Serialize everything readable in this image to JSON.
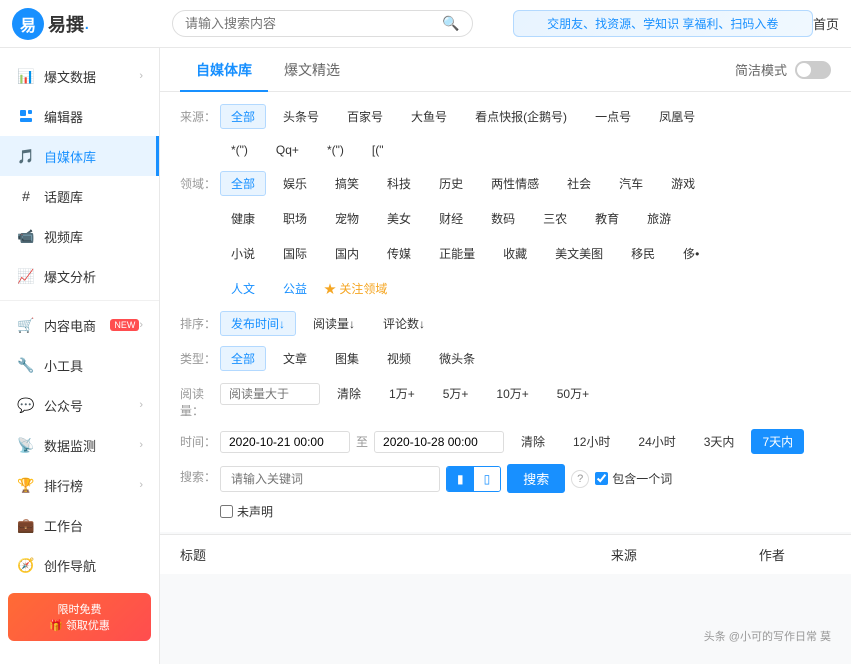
{
  "app": {
    "logo_text": "易撰",
    "logo_dot": ".",
    "search_placeholder": "请输入搜索内容",
    "banner_text": "交朋友、找资源、学知识\n享福利、扫码入卷",
    "nav_home": "首页"
  },
  "sidebar": {
    "items": [
      {
        "id": "baowendata",
        "label": "爆文数据",
        "icon": "📊",
        "has_arrow": true,
        "active": false
      },
      {
        "id": "bianji",
        "label": "编辑器",
        "icon": "✏️",
        "has_arrow": false,
        "active": false
      },
      {
        "id": "zimeiti",
        "label": "自媒体库",
        "icon": "🎵",
        "has_arrow": false,
        "active": true
      },
      {
        "id": "huati",
        "label": "话题库",
        "icon": "🏷️",
        "has_arrow": false,
        "active": false
      },
      {
        "id": "shipinku",
        "label": "视频库",
        "icon": "📹",
        "has_arrow": false,
        "active": false
      },
      {
        "id": "baowen_fenxi",
        "label": "爆文分析",
        "icon": "📈",
        "has_arrow": false,
        "active": false
      },
      {
        "id": "neirong_diangshang",
        "label": "内容电商",
        "icon": "🛒",
        "has_arrow": true,
        "active": false,
        "new_badge": true
      },
      {
        "id": "xiao_gongju",
        "label": "小工具",
        "icon": "",
        "has_arrow": false,
        "active": false
      },
      {
        "id": "gongzhonghao",
        "label": "公众号",
        "icon": "",
        "has_arrow": true,
        "active": false
      },
      {
        "id": "shuju_jiance",
        "label": "数据监测",
        "icon": "",
        "has_arrow": true,
        "active": false
      },
      {
        "id": "paihangbang",
        "label": "排行榜",
        "icon": "",
        "has_arrow": true,
        "active": false
      },
      {
        "id": "gongtai",
        "label": "工作台",
        "icon": "",
        "has_arrow": false,
        "active": false
      },
      {
        "id": "chuangzuo_daohang",
        "label": "创作导航",
        "icon": "",
        "has_arrow": false,
        "active": false
      }
    ]
  },
  "tabs": {
    "items": [
      {
        "id": "zimeiti_ku",
        "label": "自媒体库",
        "active": true
      },
      {
        "id": "baowen_jingxuan",
        "label": "爆文精选",
        "active": false
      },
      {
        "id": "jianjie_moshi",
        "label": "简洁模式",
        "active": false
      }
    ],
    "toggle_label": "简洁模式"
  },
  "filters": {
    "source_label": "来源：",
    "source_options": [
      {
        "id": "all",
        "label": "全部",
        "active": true
      },
      {
        "id": "toutiao",
        "label": "头条号",
        "active": false
      },
      {
        "id": "baijia",
        "label": "百家号",
        "active": false
      },
      {
        "id": "dayu",
        "label": "大鱼号",
        "active": false
      },
      {
        "id": "kandian",
        "label": "看点快报(企鹅号)",
        "active": false
      },
      {
        "id": "yidian",
        "label": "一点号",
        "active": false
      },
      {
        "id": "fenghuang",
        "label": "凤凰号",
        "active": false
      }
    ],
    "source_extra": [
      {
        "id": "wx",
        "label": "*(\")",
        "active": false
      },
      {
        "id": "qq",
        "label": "Qq+",
        "active": false
      },
      {
        "id": "wx2",
        "label": "*(\")",
        "active": false
      },
      {
        "id": "other",
        "label": "[(\"",
        "active": false
      }
    ],
    "domain_label": "领域：",
    "domain_options": [
      {
        "id": "all",
        "label": "全部",
        "active": true
      },
      {
        "id": "yule",
        "label": "娱乐",
        "active": false
      },
      {
        "id": "gaoxiao",
        "label": "搞笑",
        "active": false
      },
      {
        "id": "keji",
        "label": "科技",
        "active": false
      },
      {
        "id": "lishi",
        "label": "历史",
        "active": false
      },
      {
        "id": "liangxing",
        "label": "两性情感",
        "active": false
      },
      {
        "id": "shehui",
        "label": "社会",
        "active": false
      },
      {
        "id": "qiche",
        "label": "汽车",
        "active": false
      },
      {
        "id": "youxi",
        "label": "游戏",
        "active": false
      },
      {
        "id": "jiankang",
        "label": "健康",
        "active": false
      },
      {
        "id": "zhichang",
        "label": "职场",
        "active": false
      },
      {
        "id": "chongwu",
        "label": "宠物",
        "active": false
      },
      {
        "id": "meinv",
        "label": "美女",
        "active": false
      },
      {
        "id": "caijing",
        "label": "财经",
        "active": false
      },
      {
        "id": "shuma",
        "label": "数码",
        "active": false
      },
      {
        "id": "sannong",
        "label": "三农",
        "active": false
      },
      {
        "id": "jiaoyu",
        "label": "教育",
        "active": false
      },
      {
        "id": "luyou",
        "label": "旅游",
        "active": false
      },
      {
        "id": "xiaoshuo",
        "label": "小说",
        "active": false
      },
      {
        "id": "guoji",
        "label": "国际",
        "active": false
      },
      {
        "id": "guonei",
        "label": "国内",
        "active": false
      },
      {
        "id": "chuanmei",
        "label": "传媒",
        "active": false
      },
      {
        "id": "zhengneng",
        "label": "正能量",
        "active": false
      },
      {
        "id": "shoucang",
        "label": "收藏",
        "active": false
      },
      {
        "id": "meiwen_meitie",
        "label": "美文美图",
        "active": false
      },
      {
        "id": "yimin",
        "label": "移民",
        "active": false
      },
      {
        "id": "other2",
        "label": "侈•",
        "active": false
      },
      {
        "id": "renwen",
        "label": "人文",
        "active": false
      },
      {
        "id": "gongyi",
        "label": "公益",
        "active": false
      }
    ],
    "domain_link": "★ 关注领域",
    "sort_label": "排序：",
    "sort_options": [
      {
        "id": "publish_time",
        "label": "发布时间↓",
        "active": true
      },
      {
        "id": "read_count",
        "label": "阅读量↓",
        "active": false
      },
      {
        "id": "comment_count",
        "label": "评论数↓",
        "active": false
      }
    ],
    "type_label": "类型：",
    "type_options": [
      {
        "id": "all",
        "label": "全部",
        "active": true
      },
      {
        "id": "article",
        "label": "文章",
        "active": false
      },
      {
        "id": "gallery",
        "label": "图集",
        "active": false
      },
      {
        "id": "video",
        "label": "视频",
        "active": false
      },
      {
        "id": "weibiao",
        "label": "微头条",
        "active": false
      }
    ],
    "read_label": "阅读量：",
    "read_placeholder": "阅读量大于",
    "read_options": [
      {
        "id": "clear",
        "label": "清除",
        "active": false
      },
      {
        "id": "1w",
        "label": "1万+",
        "active": false
      },
      {
        "id": "5w",
        "label": "5万+",
        "active": false
      },
      {
        "id": "10w",
        "label": "10万+",
        "active": false
      },
      {
        "id": "50w",
        "label": "50万+",
        "active": false
      }
    ],
    "time_label": "时间：",
    "time_start": "2020-10-21 00:00",
    "time_end": "2020-10-28 00:00",
    "time_to": "至",
    "time_options": [
      {
        "id": "clear",
        "label": "清除",
        "active": false
      },
      {
        "id": "12h",
        "label": "12小时",
        "active": false
      },
      {
        "id": "24h",
        "label": "24小时",
        "active": false
      },
      {
        "id": "3d",
        "label": "3天内",
        "active": false
      },
      {
        "id": "7d",
        "label": "7天内",
        "active": true
      }
    ],
    "search_label": "搜索：",
    "search_placeholder": "请输入关键词",
    "search_toggle": [
      {
        "id": "blue",
        "label": "",
        "active": true
      },
      {
        "id": "white",
        "label": "",
        "active": false
      }
    ],
    "search_button": "搜索",
    "search_help": "?",
    "checkbox_label": "包含一个词",
    "undeclared_label": "未声明"
  },
  "table": {
    "columns": [
      {
        "id": "title",
        "label": "标题"
      },
      {
        "id": "source",
        "label": "来源"
      },
      {
        "id": "author",
        "label": "作者"
      }
    ]
  },
  "watermark": {
    "text": "头条 @小可的写作日常 莫"
  }
}
